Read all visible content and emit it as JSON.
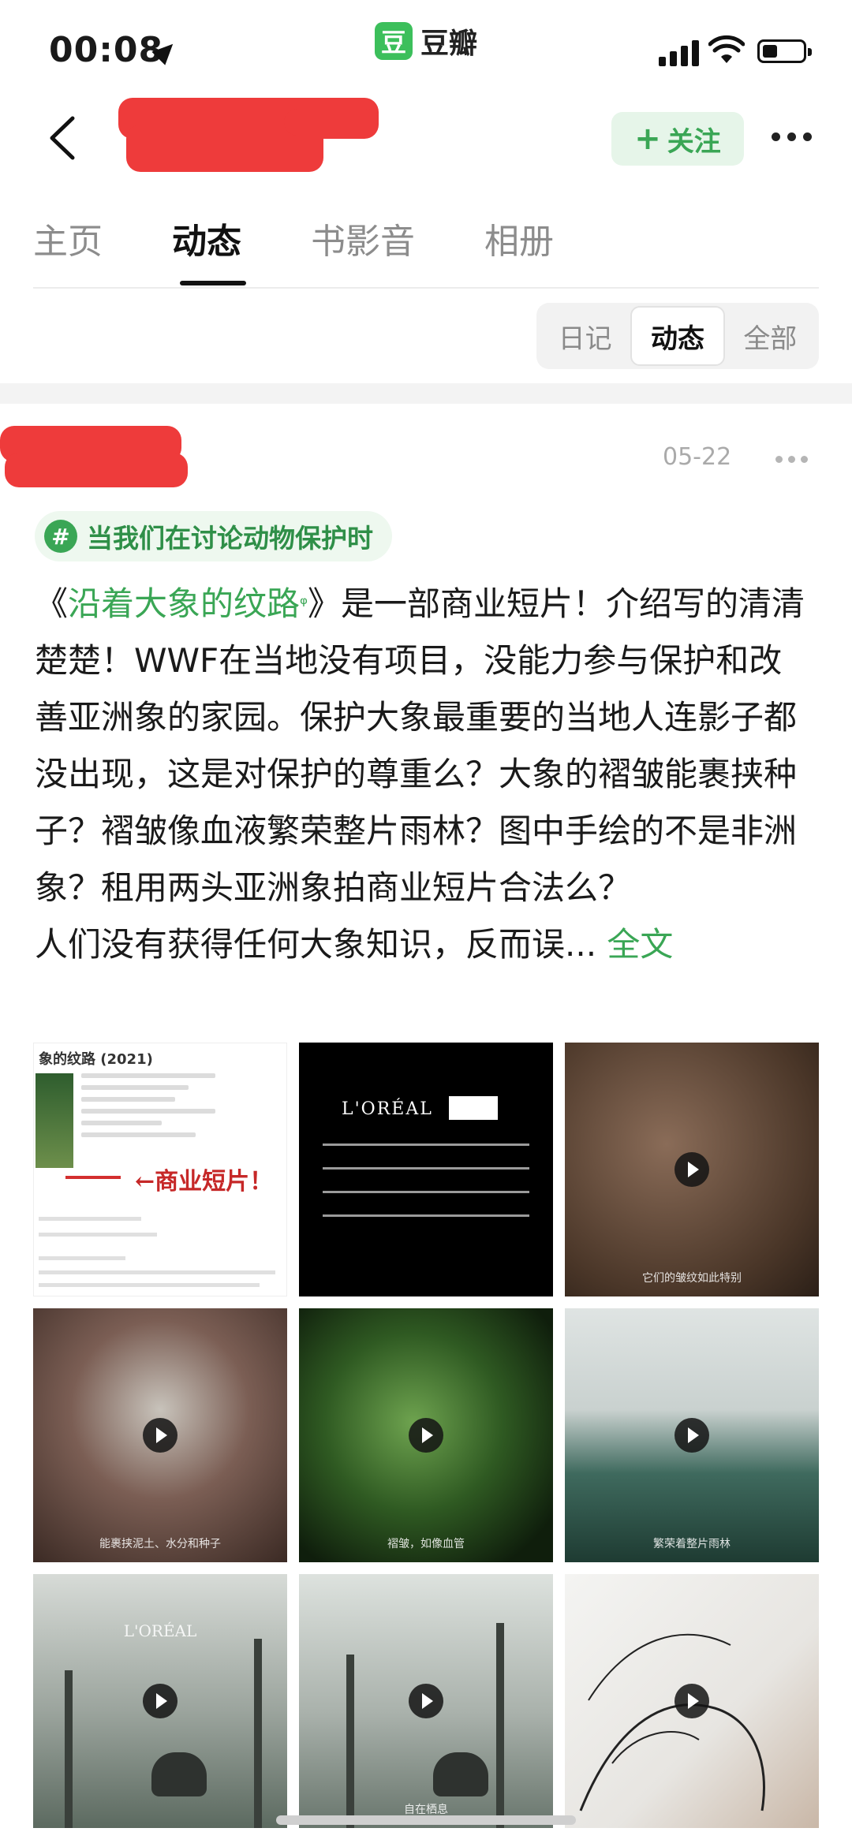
{
  "status_bar": {
    "time": "00:08",
    "app_name": "豆瓣",
    "app_logo_glyph": "豆"
  },
  "header": {
    "follow_plus": "+",
    "follow_label": "关注"
  },
  "tabs": [
    {
      "label": "主页"
    },
    {
      "label": "动态"
    },
    {
      "label": "书影音"
    },
    {
      "label": "相册"
    }
  ],
  "active_tab": "动态",
  "filter": [
    {
      "label": "日记"
    },
    {
      "label": "动态"
    },
    {
      "label": "全部"
    }
  ],
  "active_filter": "动态",
  "post": {
    "date": "05-22",
    "topic_icon": "#",
    "topic": "当我们在讨论动物保护时",
    "text_open": "《",
    "link_text": "沿着大象的纹路",
    "link_mark": "ᵠ",
    "text_body": "》是一部商业短片！介绍写的清清楚楚！WWF在当地没有项目，没能力参与保护和改善亚洲象的家园。保护大象最重要的当地人连影子都没出现，这是对保护的尊重么？大象的褶皱能裹挟种子？褶皱像血液繁荣整片雨林？图中手绘的不是非洲象？租用两头亚洲象拍商业短片合法么？",
    "text_tail": "人们没有获得任何大象知识，反而误... ",
    "fulltext_label": "全文",
    "images": {
      "tile1": {
        "title": "象的纹路 (2021)",
        "stamp": "←商业短片！"
      },
      "tile2": {
        "brand": "L'ORÉAL"
      },
      "tile3": {
        "caption": "它们的皱纹如此特别"
      },
      "tile4": {
        "caption": "能裹挟泥土、水分和种子"
      },
      "tile5": {
        "caption": "褶皱，如像血管"
      },
      "tile6": {
        "caption": "繁荣着整片雨林"
      },
      "tile7": {
        "brand": "L'ORÉAL"
      },
      "tile8": {
        "caption": "自在栖息"
      }
    }
  },
  "colors": {
    "accent_green": "#3aa655",
    "topic_bg": "#eef8ef",
    "follow_bg": "#e6f5e9",
    "redaction": "#ee3b3b"
  },
  "icons": [
    "location-arrow-icon",
    "signal-icon",
    "wifi-icon",
    "battery-icon",
    "back-chevron-icon",
    "more-dots-icon",
    "hashtag-icon",
    "play-icon"
  ]
}
